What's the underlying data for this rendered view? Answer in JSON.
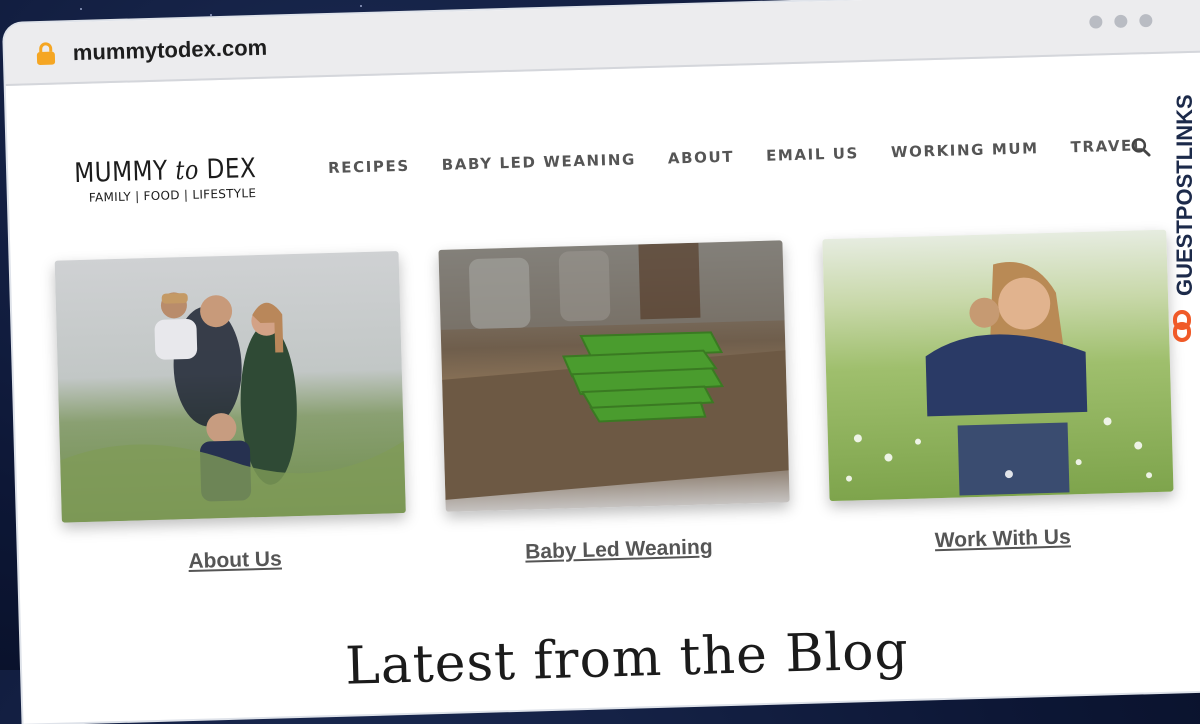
{
  "browser": {
    "url": "mummytodex.com"
  },
  "logo": {
    "main_left": "MUMMY ",
    "main_mid": "to",
    "main_right": " DEX",
    "subtitle": "FAMILY |  FOOD  | LIFESTYLE"
  },
  "nav": {
    "items": [
      {
        "label": "RECIPES"
      },
      {
        "label": "BABY LED WEANING"
      },
      {
        "label": "ABOUT"
      },
      {
        "label": "EMAIL US"
      },
      {
        "label": "WORKING MUM"
      },
      {
        "label": "TRAVEL"
      }
    ],
    "search_icon": "search-icon"
  },
  "cards": [
    {
      "link": "About Us",
      "image": "family-in-meadow-photo"
    },
    {
      "link": "Baby Led Weaning",
      "image": "green-pancakes-photo"
    },
    {
      "link": "Work With Us",
      "image": "mother-hugging-child-photo"
    }
  ],
  "blog": {
    "title": "Latest from the Blog"
  },
  "watermark": {
    "text": "GUESTPOSTLINKS",
    "color": "#f05a28"
  },
  "colors": {
    "background": "#0d1736",
    "nav_text": "#555555",
    "accent": "#f5a623"
  }
}
